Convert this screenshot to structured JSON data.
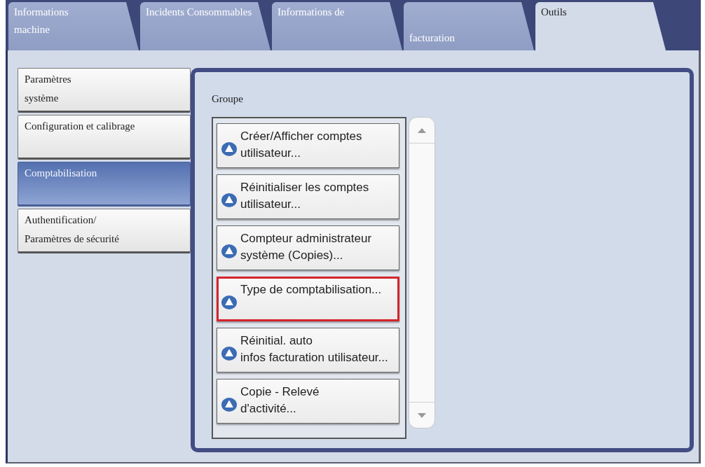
{
  "tabs": [
    {
      "label": "Informations\nmachine",
      "selected": false,
      "kind": "standard"
    },
    {
      "label": "Incidents Consommables",
      "selected": false,
      "kind": "standard"
    },
    {
      "label": "Informations de",
      "selected": false,
      "kind": "standard"
    },
    {
      "label": "facturation",
      "selected": false,
      "kind": "lowered"
    },
    {
      "label": "Outils",
      "selected": true,
      "kind": "standard"
    }
  ],
  "sidebar": {
    "items": [
      {
        "label": "Paramètres\nsystème",
        "selected": false
      },
      {
        "label": "Configuration et calibrage",
        "selected": false
      },
      {
        "label": "Comptabilisation",
        "selected": true
      },
      {
        "label": "Authentification/\nParamètres de sécurité",
        "selected": false
      }
    ]
  },
  "group": {
    "label": "Groupe",
    "items": [
      {
        "label": "Créer/Afficher comptes\nutilisateur...",
        "highlighted": false
      },
      {
        "label": "Réinitialiser les comptes\nutilisateur...",
        "highlighted": false
      },
      {
        "label": "Compteur administrateur\nsystème (Copies)...",
        "highlighted": false
      },
      {
        "label": "Type de comptabilisation...",
        "highlighted": true
      },
      {
        "label": "Réinitial. auto\ninfos facturation utilisateur...",
        "highlighted": false
      },
      {
        "label": "Copie - Relevé\nd'activité...",
        "highlighted": false
      }
    ]
  }
}
